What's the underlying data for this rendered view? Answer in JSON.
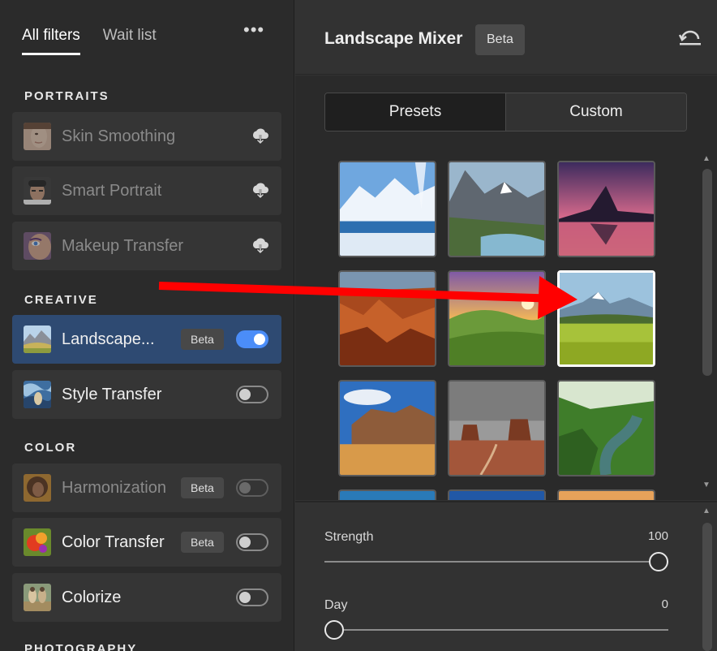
{
  "left_panel": {
    "tabs": [
      {
        "label": "All filters",
        "active": true
      },
      {
        "label": "Wait list",
        "active": false
      }
    ],
    "more_label": "•••",
    "sections": {
      "portraits": "PORTRAITS",
      "creative": "CREATIVE",
      "color": "COLOR",
      "photography": "PHOTOGRAPHY"
    },
    "items": [
      {
        "label": "Skin Smoothing",
        "state": "download",
        "icon": "cloud-download-icon"
      },
      {
        "label": "Smart Portrait",
        "state": "download",
        "icon": "cloud-download-icon"
      },
      {
        "label": "Makeup Transfer",
        "state": "download",
        "icon": "cloud-download-icon"
      },
      {
        "label": "Landscape...",
        "badge": "Beta",
        "toggle": "on",
        "selected": true
      },
      {
        "label": "Style Transfer",
        "toggle": "off"
      },
      {
        "label": "Harmonization",
        "badge": "Beta",
        "toggle": "off",
        "disabled": true
      },
      {
        "label": "Color Transfer",
        "badge": "Beta",
        "toggle": "off"
      },
      {
        "label": "Colorize",
        "toggle": "off"
      }
    ]
  },
  "right_panel": {
    "title": "Landscape Mixer",
    "badge": "Beta",
    "undo_icon": "undo-icon",
    "segmented": {
      "presets": "Presets",
      "custom": "Custom",
      "active": "Presets"
    },
    "selected_preset_index": 5,
    "presets_visible": 12,
    "sliders": [
      {
        "label": "Strength",
        "value": "100",
        "fraction": 1.0
      },
      {
        "label": "Day",
        "value": "0",
        "fraction": 0.0
      }
    ]
  },
  "colors": {
    "accent": "#4b8df8",
    "selected_item": "#2e4a72",
    "annotation_arrow": "#ff0000"
  }
}
